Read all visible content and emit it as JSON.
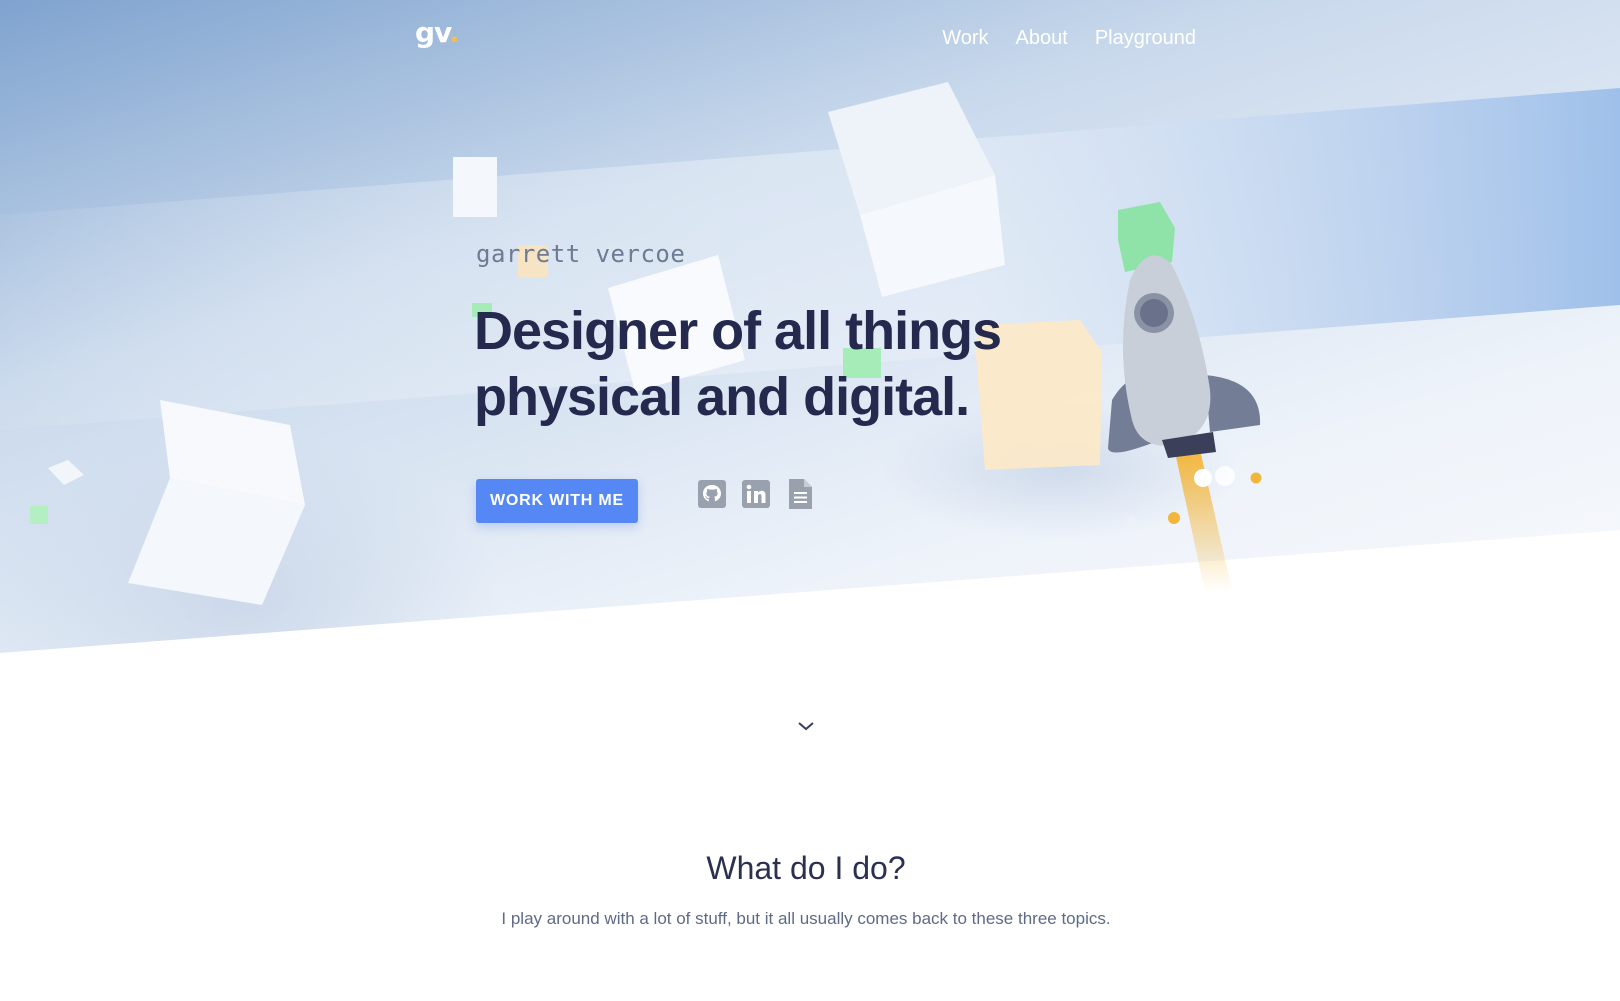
{
  "nav": {
    "logo": "gv",
    "logo_dot": ".",
    "links": [
      "Work",
      "About",
      "Playground"
    ]
  },
  "hero": {
    "name": "garrett vercoe",
    "headline_line1": "Designer of all things",
    "headline_line2": "physical and digital.",
    "cta_label": "WORK WITH ME",
    "social_icons": [
      "github-icon",
      "linkedin-icon",
      "document-icon"
    ]
  },
  "section": {
    "title": "What do I do?",
    "subtitle": "I play around with a lot of stuff, but it all usually comes back to these three topics."
  },
  "colors": {
    "accent": "#5588f5",
    "heading": "#24294d",
    "logo_dot": "#f5c04a",
    "icon_gray": "#9aa1ae"
  }
}
